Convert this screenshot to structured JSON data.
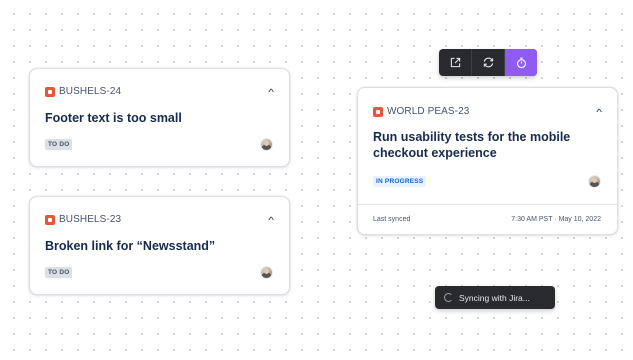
{
  "colors": {
    "issue_icon": "#e5563a",
    "todo_bg": "#dcdfe4",
    "todo_text": "#44546f",
    "inprogress_bg": "#e9f2ff",
    "inprogress_text": "#0c66e4",
    "accent": "#8f5cf0"
  },
  "cards": [
    {
      "key": "BUSHELS-24",
      "title": "Footer text is too small",
      "status": "TO DO",
      "chevron_icon": "chevron-up-icon",
      "assignee_icon": "avatar"
    },
    {
      "key": "BUSHELS-23",
      "title": "Broken link for “Newsstand”",
      "status": "TO DO",
      "chevron_icon": "chevron-up-icon",
      "assignee_icon": "avatar"
    },
    {
      "key": "WORLD PEAS-23",
      "title": "Run usability tests for the mobile checkout experience",
      "status": "IN PROGRESS",
      "chevron_icon": "chevron-up-icon",
      "assignee_icon": "avatar",
      "last_synced_label": "Last synced",
      "last_synced_value": "7:30 AM PST · May 10, 2022"
    }
  ],
  "toolbar": {
    "buttons": [
      {
        "icon": "open-external-icon"
      },
      {
        "icon": "sync-icon"
      },
      {
        "icon": "timer-icon",
        "active": true
      }
    ]
  },
  "toast": {
    "icon": "spinner-icon",
    "text": "Syncing with Jira..."
  }
}
